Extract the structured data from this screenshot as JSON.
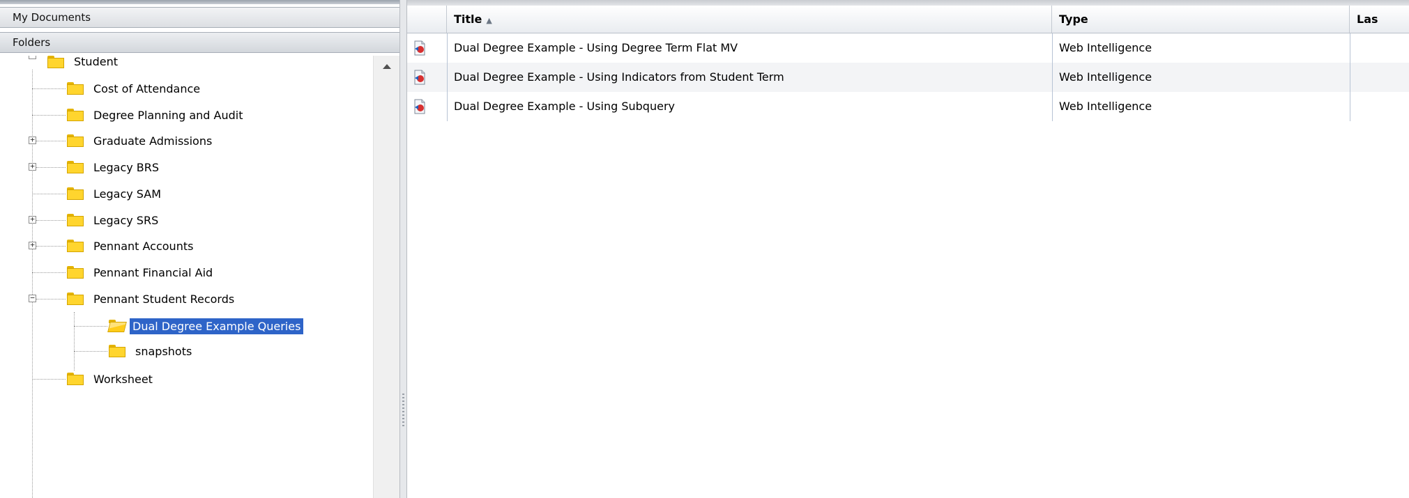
{
  "left_panel": {
    "my_documents_label": "My Documents",
    "folders_label": "Folders",
    "tree": {
      "root": {
        "label": "Student",
        "expanded": true
      },
      "children": [
        {
          "label": "Cost of Attendance",
          "has_children": false
        },
        {
          "label": "Degree Planning and Audit",
          "has_children": false
        },
        {
          "label": "Graduate Admissions",
          "has_children": true,
          "expanded": false
        },
        {
          "label": "Legacy BRS",
          "has_children": true,
          "expanded": false
        },
        {
          "label": "Legacy SAM",
          "has_children": false
        },
        {
          "label": "Legacy SRS",
          "has_children": true,
          "expanded": false
        },
        {
          "label": "Pennant Accounts",
          "has_children": true,
          "expanded": false
        },
        {
          "label": "Pennant Financial Aid",
          "has_children": false
        },
        {
          "label": "Pennant Student Records",
          "has_children": true,
          "expanded": true,
          "children": [
            {
              "label": "Dual Degree Example Queries",
              "selected": true
            },
            {
              "label": "snapshots"
            }
          ]
        },
        {
          "label": "Worksheet",
          "has_children": false
        }
      ]
    }
  },
  "grid": {
    "columns": [
      {
        "label": "Title",
        "sort": "ascending"
      },
      {
        "label": "Type"
      },
      {
        "label": "Las"
      }
    ],
    "rows": [
      {
        "title": "Dual Degree Example - Using Degree Term Flat MV",
        "type": "Web Intelligence"
      },
      {
        "title": "Dual Degree Example - Using Indicators from Student Term",
        "type": "Web Intelligence"
      },
      {
        "title": "Dual Degree Example - Using Subquery",
        "type": "Web Intelligence"
      }
    ]
  },
  "icons": {
    "expanded": "minus-box-icon",
    "collapsed": "plus-box-icon",
    "folder": "folder-icon",
    "folder_open": "folder-open-icon",
    "document": "web-intelligence-document-icon",
    "sort": "sort-ascending-icon",
    "scroll_up": "scroll-up-arrow-icon"
  },
  "colors": {
    "selection": "#2e64c8",
    "folder": "#ffd52e",
    "header_border": "#a7aeb7"
  }
}
